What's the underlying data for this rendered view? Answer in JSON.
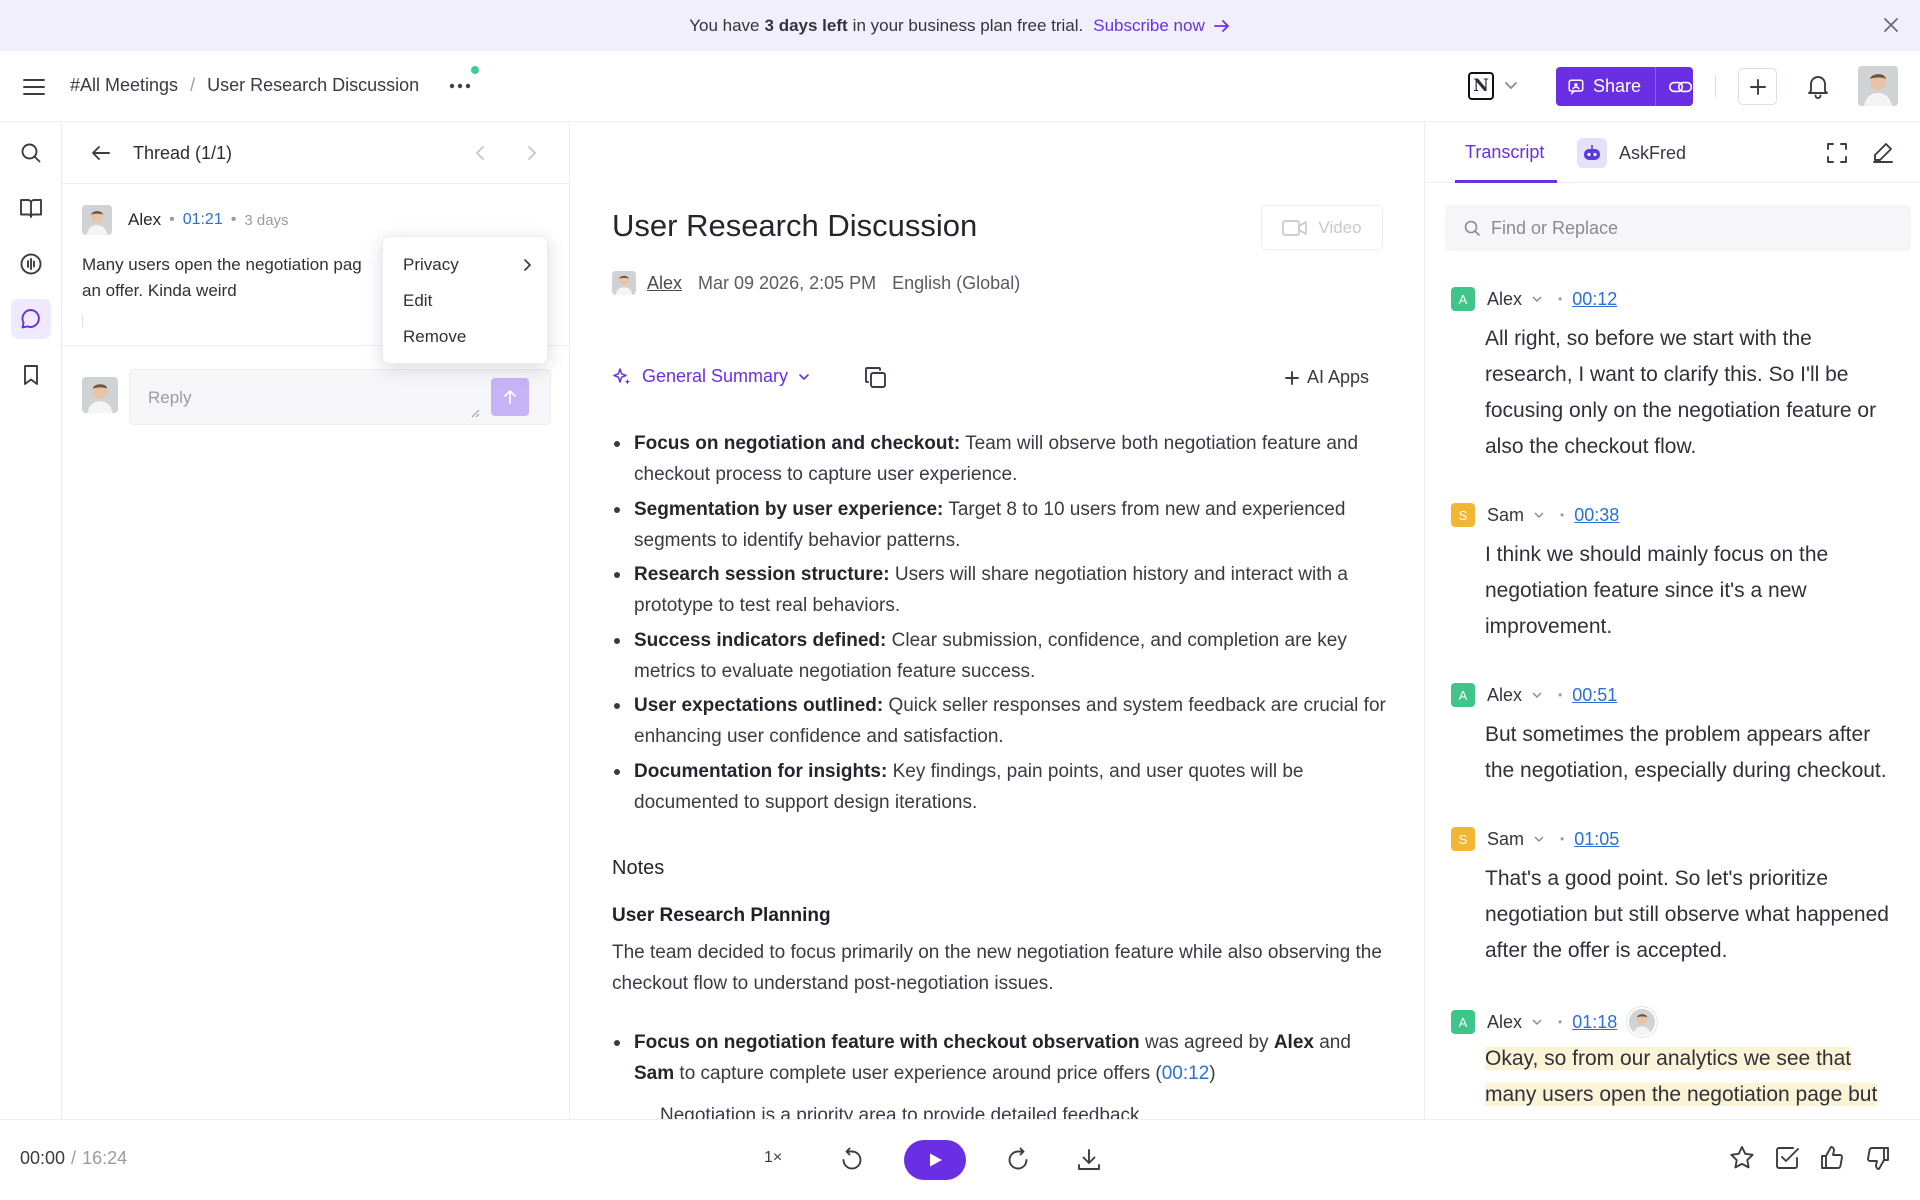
{
  "banner": {
    "text_before": "You have",
    "days_left": "3 days left",
    "text_after": "in your business plan free trial.",
    "link": "Subscribe now"
  },
  "header": {
    "breadcrumb_root": "#All Meetings",
    "breadcrumb_sep": "/",
    "breadcrumb_current": "User Research Discussion",
    "share_label": "Share"
  },
  "thread": {
    "title": "Thread (1/1)",
    "comment": {
      "author": "Alex",
      "timestamp": "01:21",
      "age": "3 days",
      "text_line1": "Many users open the negotiation pag",
      "text_line2": "an offer. Kinda weird"
    },
    "reply_placeholder": "Reply",
    "context_menu": [
      "Privacy",
      "Edit",
      "Remove"
    ]
  },
  "meeting": {
    "title": "User Research Discussion",
    "video_label": "Video",
    "owner": "Alex",
    "datetime": "Mar 09 2026, 2:05 PM",
    "language": "English (Global)",
    "summary_selector": "General Summary",
    "ai_apps_label": "AI Apps",
    "summary_items": [
      {
        "bold": "Focus on negotiation and checkout:",
        "text": "Team will observe both negotiation feature and checkout process to capture user experience."
      },
      {
        "bold": "Segmentation by user experience:",
        "text": "Target 8 to 10 users from new and experienced segments to identify behavior patterns."
      },
      {
        "bold": "Research session structure:",
        "text": "Users will share negotiation history and interact with a prototype to test real behaviors."
      },
      {
        "bold": "Success indicators defined:",
        "text": "Clear submission, confidence, and completion are key metrics to evaluate negotiation feature success."
      },
      {
        "bold": "User expectations outlined:",
        "text": "Quick seller responses and system feedback are crucial for enhancing user confidence and satisfaction."
      },
      {
        "bold": "Documentation for insights:",
        "text": "Key findings, pain points, and user quotes will be documented to support design iterations."
      }
    ],
    "notes_heading": "Notes",
    "notes_subheading": "User Research Planning",
    "notes_paragraph": "The team decided to focus primarily on the new negotiation feature while also observing the checkout flow to understand post-negotiation issues.",
    "note_bullet": {
      "bold": "Focus on negotiation feature with checkout observation",
      "mid1": "was agreed by",
      "name1": "Alex",
      "mid2": "and",
      "name2": "Sam",
      "rest": "to capture complete user experience around price offers (",
      "time": "00:12",
      "close": ")"
    },
    "cut_line": "Negotiation is a priority area to provide detailed feedback"
  },
  "transcript": {
    "tabs": [
      "Transcript",
      "AskFred"
    ],
    "search_placeholder": "Find or Replace",
    "entries": [
      {
        "badge": "A",
        "speaker": "Alex",
        "time": "00:12",
        "text": "All right, so before we start with the research, I want to clarify this. So I'll be focusing only on the negotiation feature or also the checkout flow."
      },
      {
        "badge": "S",
        "speaker": "Sam",
        "time": "00:38",
        "text": "I think we should mainly focus on the negotiation feature since it's a new improvement."
      },
      {
        "badge": "A",
        "speaker": "Alex",
        "time": "00:51",
        "text": "But sometimes the problem appears after the negotiation, especially during checkout."
      },
      {
        "badge": "S",
        "speaker": "Sam",
        "time": "01:05",
        "text": "That's a good point. So let's prioritize negotiation but still observe what happened after the offer is accepted."
      },
      {
        "badge": "A",
        "speaker": "Alex",
        "time": "01:18",
        "text_hl1": "Okay, so from our analytics we see that",
        "text_hl2": "many users open the negotiation page but"
      }
    ],
    "colors": {
      "alex": "#3fc48a",
      "sam": "#f2b632",
      "highlight": "#fbf3d6"
    }
  },
  "player": {
    "current": "00:00",
    "sep": "/",
    "total": "16:24",
    "speed": "1×"
  },
  "colors": {
    "accent": "#6a2fe2",
    "link": "#2a6fd6",
    "banner_bg": "#f1f0fa"
  }
}
